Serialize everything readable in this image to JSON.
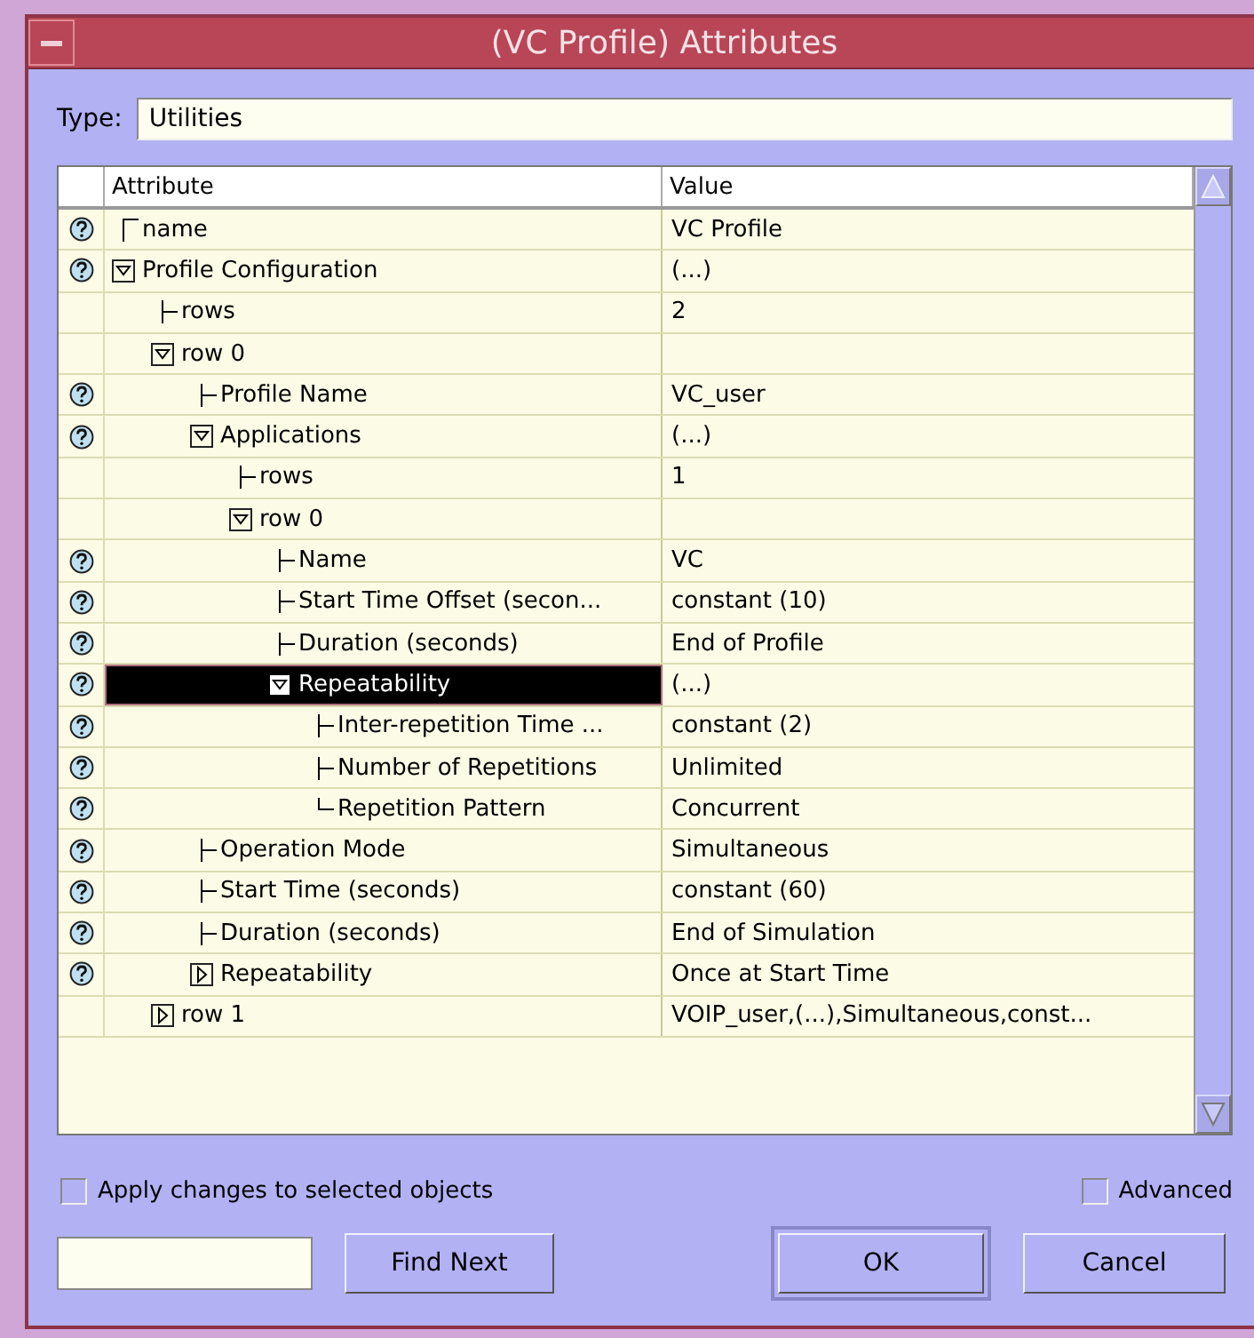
{
  "window": {
    "title": "(VC Profile) Attributes"
  },
  "type_field": {
    "label": "Type:",
    "value": "Utilities"
  },
  "table": {
    "columns": [
      "Attribute",
      "Value"
    ],
    "tree": [
      {
        "label": "name",
        "kind": "field",
        "help": true,
        "selected": false,
        "value": "VC Profile"
      },
      {
        "label": "Profile Configuration",
        "kind": "group",
        "expanded": true,
        "help": true,
        "selected": false,
        "value": "(...)",
        "children": [
          {
            "label": "rows",
            "kind": "field",
            "help": false,
            "selected": false,
            "value": "2"
          },
          {
            "label": "row 0",
            "kind": "group",
            "expanded": true,
            "help": false,
            "selected": false,
            "children": [
              {
                "label": "Profile Name",
                "kind": "field",
                "help": true,
                "selected": false,
                "value": "VC_user"
              },
              {
                "label": "Applications",
                "kind": "group",
                "expanded": true,
                "help": true,
                "selected": false,
                "value": "(...)",
                "children": [
                  {
                    "label": "rows",
                    "kind": "field",
                    "help": false,
                    "selected": false,
                    "value": "1"
                  },
                  {
                    "label": "row 0",
                    "kind": "group",
                    "expanded": true,
                    "help": false,
                    "selected": false,
                    "children": [
                      {
                        "label": "Name",
                        "kind": "field",
                        "help": true,
                        "selected": false,
                        "value": "VC"
                      },
                      {
                        "label": "Start Time Offset (secon...",
                        "kind": "field",
                        "help": true,
                        "selected": false,
                        "value": "constant (10)"
                      },
                      {
                        "label": "Duration (seconds)",
                        "kind": "field",
                        "help": true,
                        "selected": false,
                        "value": "End of Profile"
                      },
                      {
                        "label": "Repeatability",
                        "kind": "group",
                        "expanded": true,
                        "help": true,
                        "selected": true,
                        "value": "(...)",
                        "children": [
                          {
                            "label": "Inter-repetition Time ...",
                            "kind": "field",
                            "help": true,
                            "selected": false,
                            "value": "constant (2)"
                          },
                          {
                            "label": "Number of Repetitions",
                            "kind": "field",
                            "help": true,
                            "selected": false,
                            "value": "Unlimited"
                          },
                          {
                            "label": "Repetition Pattern",
                            "kind": "field",
                            "help": true,
                            "selected": false,
                            "value": "Concurrent"
                          }
                        ]
                      }
                    ]
                  }
                ]
              },
              {
                "label": "Operation Mode",
                "kind": "field",
                "help": true,
                "selected": false,
                "value": "Simultaneous"
              },
              {
                "label": "Start Time (seconds)",
                "kind": "field",
                "help": true,
                "selected": false,
                "value": "constant (60)"
              },
              {
                "label": "Duration (seconds)",
                "kind": "field",
                "help": true,
                "selected": false,
                "value": "End of Simulation"
              },
              {
                "label": "Repeatability",
                "kind": "group",
                "expanded": false,
                "help": true,
                "selected": false,
                "value": "Once at Start Time"
              }
            ]
          },
          {
            "label": "row 1",
            "kind": "group",
            "expanded": false,
            "help": false,
            "selected": false,
            "value": "VOIP_user,(...),Simultaneous,const..."
          }
        ]
      }
    ]
  },
  "options": [
    {
      "label": "Apply changes to selected objects",
      "checked": false
    },
    {
      "label": "Advanced",
      "checked": false
    }
  ],
  "buttons": [
    {
      "label": "Find Next",
      "kind": "find"
    },
    {
      "label": "OK",
      "kind": "default"
    },
    {
      "label": "Cancel",
      "kind": "normal"
    }
  ]
}
